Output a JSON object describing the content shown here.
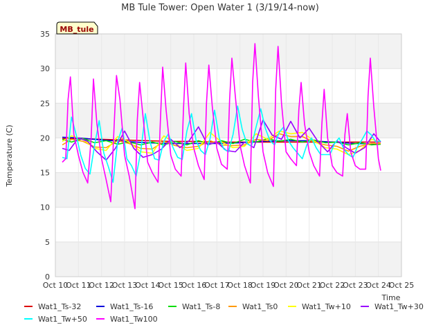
{
  "chart_data": {
    "type": "line",
    "title": "MB Tule Tower: Open Water 1 (3/19/14-now)",
    "site_label": "MB_tule",
    "xlabel": "Time",
    "ylabel": "Temperature (C)",
    "xlim": [
      10,
      25
    ],
    "ylim": [
      0,
      35
    ],
    "x_ticks": [
      {
        "v": 10,
        "label": "Oct 10"
      },
      {
        "v": 11,
        "label": "Oct 11"
      },
      {
        "v": 12,
        "label": "Oct 12"
      },
      {
        "v": 13,
        "label": "Oct 13"
      },
      {
        "v": 14,
        "label": "Oct 14"
      },
      {
        "v": 15,
        "label": "Oct 15"
      },
      {
        "v": 16,
        "label": "Oct 16"
      },
      {
        "v": 17,
        "label": "Oct 17"
      },
      {
        "v": 18,
        "label": "Oct 18"
      },
      {
        "v": 19,
        "label": "Oct 19"
      },
      {
        "v": 20,
        "label": "Oct 20"
      },
      {
        "v": 21,
        "label": "Oct 21"
      },
      {
        "v": 22,
        "label": "Oct 22"
      },
      {
        "v": 23,
        "label": "Oct 23"
      },
      {
        "v": 24,
        "label": "Oct 24"
      },
      {
        "v": 25,
        "label": "Oct 25"
      }
    ],
    "y_ticks": [
      0,
      5,
      10,
      15,
      20,
      25,
      30,
      35
    ],
    "grid": true,
    "legend_position": "bottom",
    "series": [
      {
        "name": "Wat1_Ts-32",
        "color": "#dd0000",
        "x": [
          10.3,
          11,
          12,
          13,
          14,
          15,
          16,
          17,
          18,
          19,
          20,
          21,
          22,
          23,
          24.1
        ],
        "values": [
          19.9,
          19.9,
          19.8,
          19.7,
          19.6,
          19.5,
          19.5,
          19.4,
          19.4,
          19.4,
          19.4,
          19.4,
          19.4,
          19.4,
          19.4
        ]
      },
      {
        "name": "Wat1_Ts-16",
        "color": "#0000dd",
        "x": [
          10.3,
          11,
          12,
          13,
          14,
          15,
          16,
          17,
          18,
          19,
          20,
          21,
          22,
          23,
          24.1
        ],
        "values": [
          20.1,
          20.0,
          19.7,
          19.5,
          19.3,
          19.2,
          19.2,
          19.2,
          19.3,
          19.5,
          19.6,
          19.6,
          19.4,
          19.2,
          19.1
        ]
      },
      {
        "name": "Wat1_Ts-8",
        "color": "#00dd00",
        "x": [
          10.3,
          10.7,
          11.2,
          11.7,
          12.2,
          12.7,
          13.2,
          13.7,
          14.2,
          14.7,
          15.2,
          15.7,
          16.2,
          16.7,
          17.2,
          17.7,
          18.2,
          18.7,
          19.2,
          19.7,
          20.2,
          20.7,
          21.2,
          21.7,
          22.2,
          22.7,
          23.2,
          23.7,
          24.1
        ],
        "values": [
          19.8,
          19.4,
          19.9,
          19.3,
          19.6,
          19.1,
          19.4,
          19.0,
          19.4,
          19.0,
          19.5,
          19.0,
          19.6,
          19.1,
          19.6,
          19.2,
          19.8,
          19.4,
          19.9,
          19.5,
          19.8,
          19.4,
          19.7,
          19.3,
          19.4,
          19.0,
          19.3,
          19.0,
          19.1
        ]
      },
      {
        "name": "Wat1_Ts0",
        "color": "#ff9900",
        "x": [
          10.3,
          10.7,
          11.2,
          11.7,
          12.2,
          12.7,
          13.2,
          13.7,
          14.2,
          14.7,
          15.2,
          15.7,
          16.2,
          16.7,
          17.2,
          17.7,
          18.2,
          18.7,
          19.2,
          19.7,
          20.2,
          20.7,
          21.2,
          21.7,
          22.2,
          22.7,
          23.2,
          23.7,
          24.1
        ],
        "values": [
          19.0,
          19.8,
          19.5,
          18.7,
          18.6,
          19.6,
          19.2,
          18.5,
          18.4,
          19.5,
          18.9,
          18.6,
          18.8,
          19.6,
          19.0,
          18.9,
          19.0,
          19.8,
          19.6,
          20.6,
          20.2,
          20.2,
          19.4,
          19.0,
          18.8,
          18.1,
          18.8,
          19.2,
          19.2
        ]
      },
      {
        "name": "Wat1_Tw+10",
        "color": "#ffff00",
        "x": [
          10.3,
          10.7,
          11.2,
          11.7,
          12.2,
          12.7,
          13.2,
          13.7,
          14.2,
          14.7,
          15.2,
          15.7,
          16.2,
          16.7,
          17.2,
          17.7,
          18.2,
          18.7,
          19.2,
          19.7,
          20.2,
          20.7,
          21.2,
          21.7,
          22.2,
          22.7,
          23.2,
          23.7,
          24.1
        ],
        "values": [
          19.5,
          20.3,
          19.8,
          18.5,
          18.2,
          20.2,
          19.4,
          18.0,
          17.8,
          20.3,
          19.2,
          18.2,
          18.5,
          20.8,
          19.4,
          18.6,
          18.8,
          20.6,
          19.8,
          21.0,
          20.6,
          20.8,
          19.6,
          18.6,
          18.4,
          17.6,
          18.2,
          19.8,
          19.4
        ]
      },
      {
        "name": "Wat1_Tw+30",
        "color": "#9900ff",
        "x": [
          10.3,
          10.6,
          11.0,
          11.4,
          11.8,
          12.2,
          12.6,
          13.0,
          13.4,
          13.8,
          14.2,
          14.6,
          15.0,
          15.4,
          15.8,
          16.2,
          16.6,
          17.0,
          17.4,
          17.8,
          18.2,
          18.6,
          19.0,
          19.4,
          19.8,
          20.2,
          20.6,
          21.0,
          21.4,
          21.8,
          22.2,
          22.6,
          23.0,
          23.4,
          23.8,
          24.1
        ],
        "values": [
          18.5,
          18.2,
          20.0,
          19.5,
          18.0,
          16.8,
          18.5,
          21.0,
          18.5,
          17.2,
          17.6,
          18.4,
          19.8,
          18.6,
          19.6,
          21.6,
          19.0,
          19.4,
          18.2,
          18.0,
          19.4,
          18.6,
          22.6,
          20.4,
          19.8,
          22.4,
          20.0,
          21.4,
          19.4,
          18.0,
          19.6,
          18.6,
          17.8,
          18.6,
          20.6,
          19.4
        ]
      },
      {
        "name": "Wat1_Tw+50",
        "color": "#00ffff",
        "x": [
          10.3,
          10.5,
          10.7,
          10.9,
          11.1,
          11.3,
          11.5,
          11.7,
          11.9,
          12.1,
          12.3,
          12.5,
          12.7,
          12.9,
          13.1,
          13.3,
          13.5,
          13.7,
          13.9,
          14.1,
          14.3,
          14.5,
          14.7,
          14.9,
          15.1,
          15.3,
          15.5,
          15.7,
          15.9,
          16.1,
          16.3,
          16.5,
          16.7,
          16.9,
          17.1,
          17.3,
          17.5,
          17.7,
          17.9,
          18.1,
          18.3,
          18.5,
          18.7,
          18.9,
          19.1,
          19.3,
          19.5,
          19.7,
          19.9,
          20.1,
          20.3,
          20.5,
          20.7,
          20.9,
          21.1,
          21.3,
          21.5,
          21.7,
          21.9,
          22.1,
          22.3,
          22.5,
          22.7,
          22.9,
          23.1,
          23.3,
          23.5,
          23.7,
          23.9,
          24.1
        ],
        "values": [
          17.2,
          17.0,
          23.0,
          20.5,
          17.5,
          15.6,
          14.8,
          19.0,
          22.5,
          17.8,
          15.8,
          13.6,
          19.5,
          21.5,
          17.0,
          16.0,
          14.5,
          18.0,
          23.5,
          19.5,
          17.0,
          16.8,
          19.5,
          20.6,
          18.6,
          17.2,
          16.9,
          21.0,
          23.5,
          19.6,
          18.2,
          17.6,
          19.8,
          24.0,
          20.0,
          18.4,
          18.0,
          20.5,
          24.6,
          21.2,
          19.2,
          18.8,
          21.6,
          24.2,
          21.4,
          19.6,
          19.0,
          20.8,
          21.6,
          19.6,
          18.6,
          17.8,
          17.0,
          19.0,
          20.0,
          18.6,
          17.6,
          17.6,
          17.6,
          19.2,
          20.0,
          18.4,
          17.6,
          17.2,
          18.8,
          19.8,
          21.0,
          20.4,
          19.4,
          19.6
        ]
      },
      {
        "name": "Wat1_Tw100",
        "color": "#ff00ff",
        "x": [
          10.3,
          10.45,
          10.55,
          10.65,
          10.8,
          11.0,
          11.2,
          11.4,
          11.55,
          11.65,
          11.8,
          12.0,
          12.2,
          12.4,
          12.55,
          12.65,
          12.8,
          13.0,
          13.2,
          13.45,
          13.55,
          13.65,
          13.8,
          14.0,
          14.2,
          14.45,
          14.55,
          14.65,
          14.8,
          15.0,
          15.2,
          15.45,
          15.55,
          15.65,
          15.8,
          16.0,
          16.2,
          16.45,
          16.55,
          16.65,
          16.8,
          17.0,
          17.2,
          17.45,
          17.55,
          17.65,
          17.8,
          18.0,
          18.2,
          18.45,
          18.55,
          18.65,
          18.8,
          19.0,
          19.2,
          19.45,
          19.55,
          19.65,
          19.8,
          20.0,
          20.2,
          20.45,
          20.55,
          20.65,
          20.8,
          21.0,
          21.2,
          21.45,
          21.55,
          21.65,
          21.8,
          22.0,
          22.2,
          22.45,
          22.55,
          22.65,
          22.8,
          23.0,
          23.2,
          23.45,
          23.55,
          23.65,
          23.8,
          24.0,
          24.1
        ],
        "values": [
          16.5,
          17.0,
          25.5,
          28.8,
          20.5,
          17.5,
          15.0,
          13.5,
          20.0,
          28.5,
          22.0,
          17.0,
          14.0,
          10.8,
          22.0,
          29.0,
          25.5,
          17.5,
          14.5,
          9.8,
          22.5,
          28.0,
          23.0,
          16.5,
          15.0,
          13.6,
          22.5,
          30.2,
          24.0,
          17.5,
          15.5,
          14.5,
          24.0,
          30.8,
          23.5,
          18.5,
          16.0,
          14.0,
          25.0,
          30.5,
          24.5,
          18.5,
          16.2,
          15.5,
          25.5,
          31.5,
          26.0,
          19.0,
          16.0,
          13.5,
          28.0,
          33.6,
          26.0,
          18.0,
          15.0,
          13.0,
          27.0,
          33.2,
          25.0,
          18.0,
          17.0,
          16.0,
          24.0,
          28.0,
          22.0,
          18.0,
          16.0,
          14.5,
          22.0,
          27.0,
          20.0,
          16.0,
          15.0,
          14.5,
          20.5,
          23.5,
          18.0,
          16.0,
          15.5,
          15.5,
          26.0,
          31.5,
          24.5,
          17.0,
          15.3
        ]
      }
    ]
  }
}
